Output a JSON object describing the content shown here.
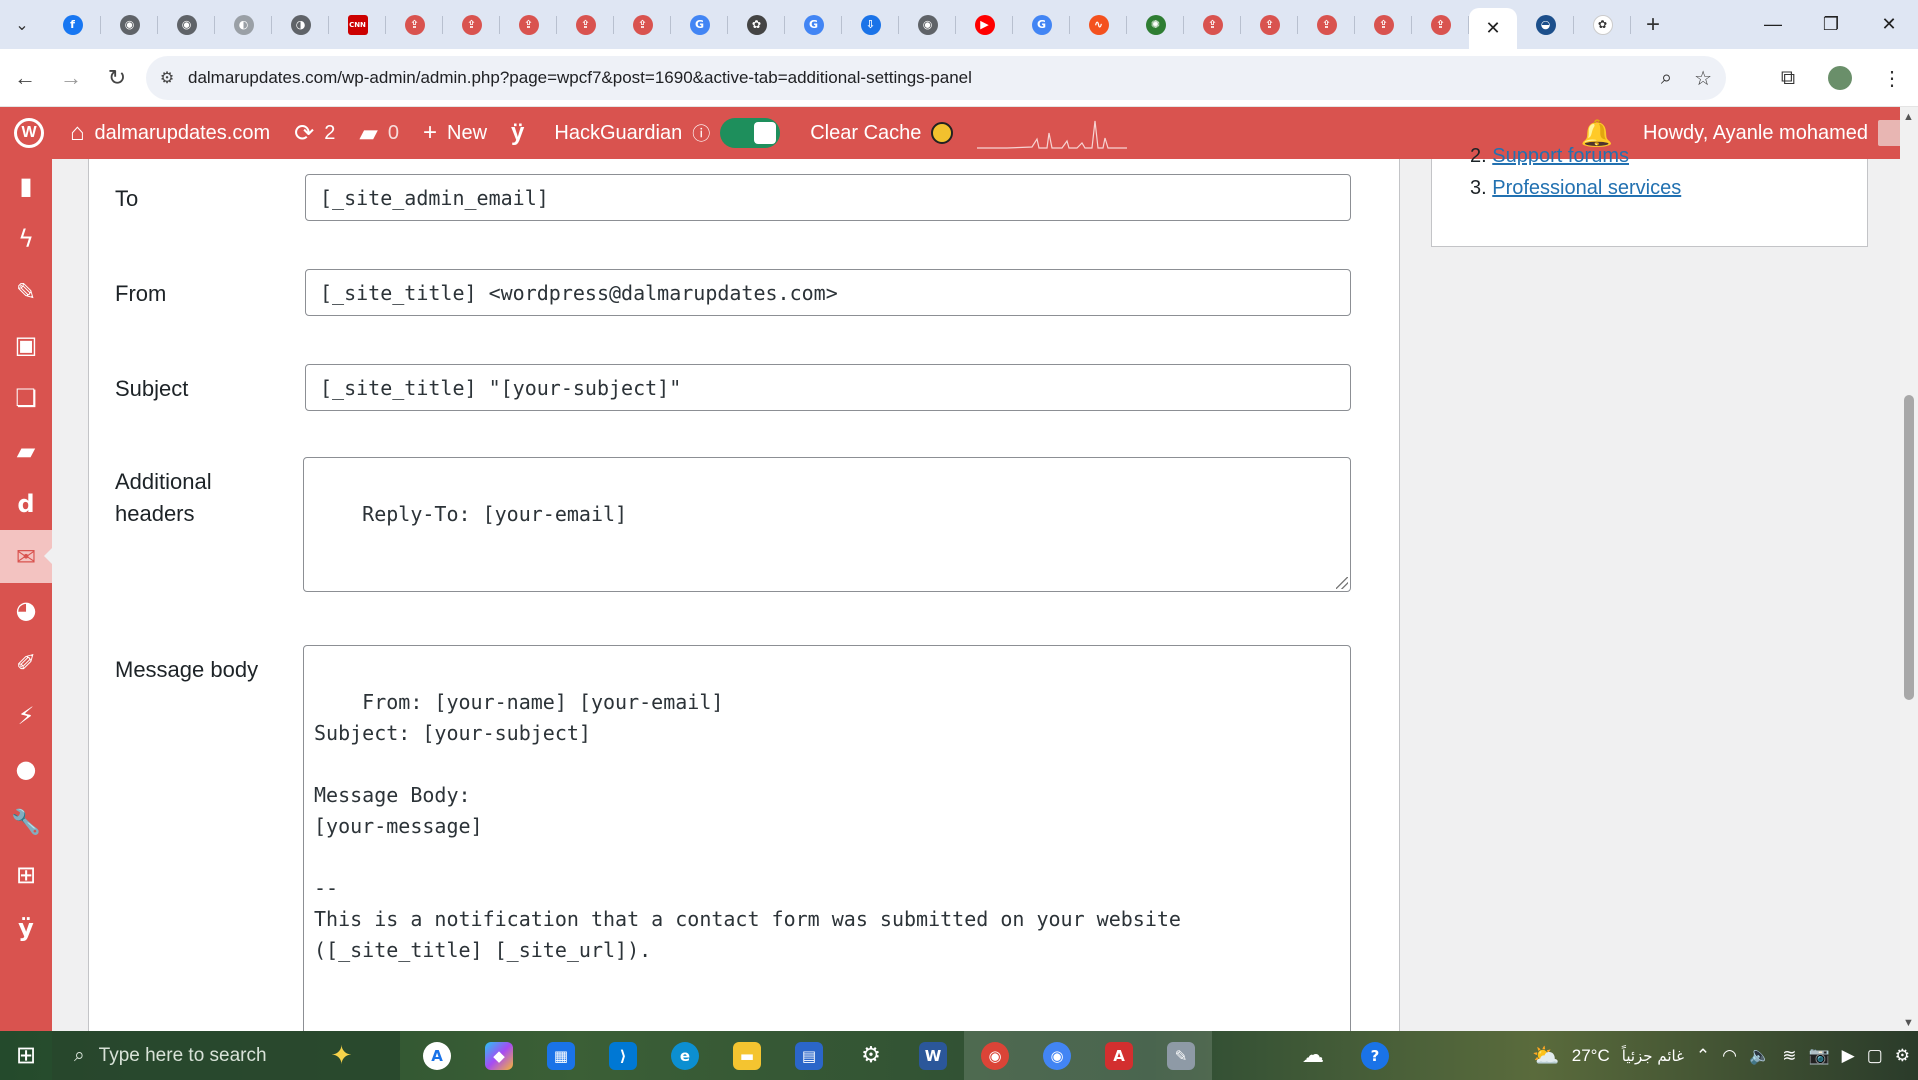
{
  "browser": {
    "tabs": [
      {
        "icon": "facebook-icon",
        "color": "#1877f2",
        "glyph": "f"
      },
      {
        "icon": "chrome-icon",
        "color": "#5f6368",
        "glyph": "◉"
      },
      {
        "icon": "chrome-icon",
        "color": "#5f6368",
        "glyph": "◉"
      },
      {
        "icon": "globe-icon",
        "color": "#9aa0a6",
        "glyph": "◐"
      },
      {
        "icon": "globe-icon",
        "color": "#5f6368",
        "glyph": "◑"
      },
      {
        "icon": "cnn-icon",
        "color": "#cc0000",
        "glyph": "CNN"
      },
      {
        "icon": "upload-icon",
        "color": "#d9534f",
        "glyph": "⇪"
      },
      {
        "icon": "upload-icon",
        "color": "#d9534f",
        "glyph": "⇪"
      },
      {
        "icon": "upload-icon",
        "color": "#d9534f",
        "glyph": "⇪"
      },
      {
        "icon": "upload-icon",
        "color": "#d9534f",
        "glyph": "⇪"
      },
      {
        "icon": "upload-icon",
        "color": "#d9534f",
        "glyph": "⇪"
      },
      {
        "icon": "google-icon",
        "color": "#4285f4",
        "glyph": "G"
      },
      {
        "icon": "openai-icon",
        "color": "#444444",
        "glyph": "✿"
      },
      {
        "icon": "google-icon",
        "color": "#4285f4",
        "glyph": "G"
      },
      {
        "icon": "download-icon",
        "color": "#1a73e8",
        "glyph": "⇩"
      },
      {
        "icon": "chrome-icon",
        "color": "#5f6368",
        "glyph": "◉"
      },
      {
        "icon": "youtube-icon",
        "color": "#ff0000",
        "glyph": "▶"
      },
      {
        "icon": "google-icon",
        "color": "#4285f4",
        "glyph": "G"
      },
      {
        "icon": "analytics-icon",
        "color": "#f4511e",
        "glyph": "∿"
      },
      {
        "icon": "octopus-icon",
        "color": "#2e7d32",
        "glyph": "✺"
      },
      {
        "icon": "upload-icon",
        "color": "#d9534f",
        "glyph": "⇪"
      },
      {
        "icon": "upload-icon",
        "color": "#d9534f",
        "glyph": "⇪"
      },
      {
        "icon": "upload-icon",
        "color": "#d9534f",
        "glyph": "⇪"
      },
      {
        "icon": "upload-icon",
        "color": "#d9534f",
        "glyph": "⇪"
      },
      {
        "icon": "upload-icon",
        "color": "#d9534f",
        "glyph": "⇪"
      }
    ],
    "url": "dalmarupdates.com/wp-admin/admin.php?page=wpcf7&post=1690&active-tab=additional-settings-panel"
  },
  "adminbar": {
    "site_name": "dalmarupdates.com",
    "updates_count": "2",
    "comments_count": "0",
    "new_label": "New",
    "hackguardian_label": "HackGuardian",
    "clear_cache_label": "Clear Cache",
    "howdy_label": "Howdy, Ayanle mohamed",
    "accent_color": "#d9534f"
  },
  "sidemenu": {
    "icons": [
      "dashboard-icon",
      "activity-icon",
      "pin-icon",
      "media-icon",
      "pages-icon",
      "comments-icon",
      "divi-icon",
      "mail-icon",
      "appearance-icon",
      "tools-icon",
      "plugins-icon",
      "users-icon",
      "wrench-icon",
      "settings-icon",
      "yoast-icon"
    ],
    "current": "mail-icon"
  },
  "form": {
    "to_label": "To",
    "to_value": "[_site_admin_email]",
    "from_label": "From",
    "from_value": "[_site_title] <wordpress@dalmarupdates.com>",
    "subject_label": "Subject",
    "subject_value": "[_site_title] \"[your-subject]\"",
    "additional_headers_label_line1": "Additional",
    "additional_headers_label_line2": "headers",
    "additional_headers_value": "Reply-To: [your-email]",
    "message_body_label": "Message body",
    "message_body_value": "From: [your-name] [your-email]\nSubject: [your-subject]\n\nMessage Body:\n[your-message]\n\n--\nThis is a notification that a contact form was submitted on your website\n([_site_title] [_site_url])."
  },
  "sidebar": {
    "item2_number": "2.",
    "item2_label": "Support forums",
    "item3_number": "3.",
    "item3_label": "Professional services"
  },
  "taskbar": {
    "search_placeholder": "Type here to search",
    "temperature": "27°C",
    "weather_text": "غائم جزئياً"
  }
}
